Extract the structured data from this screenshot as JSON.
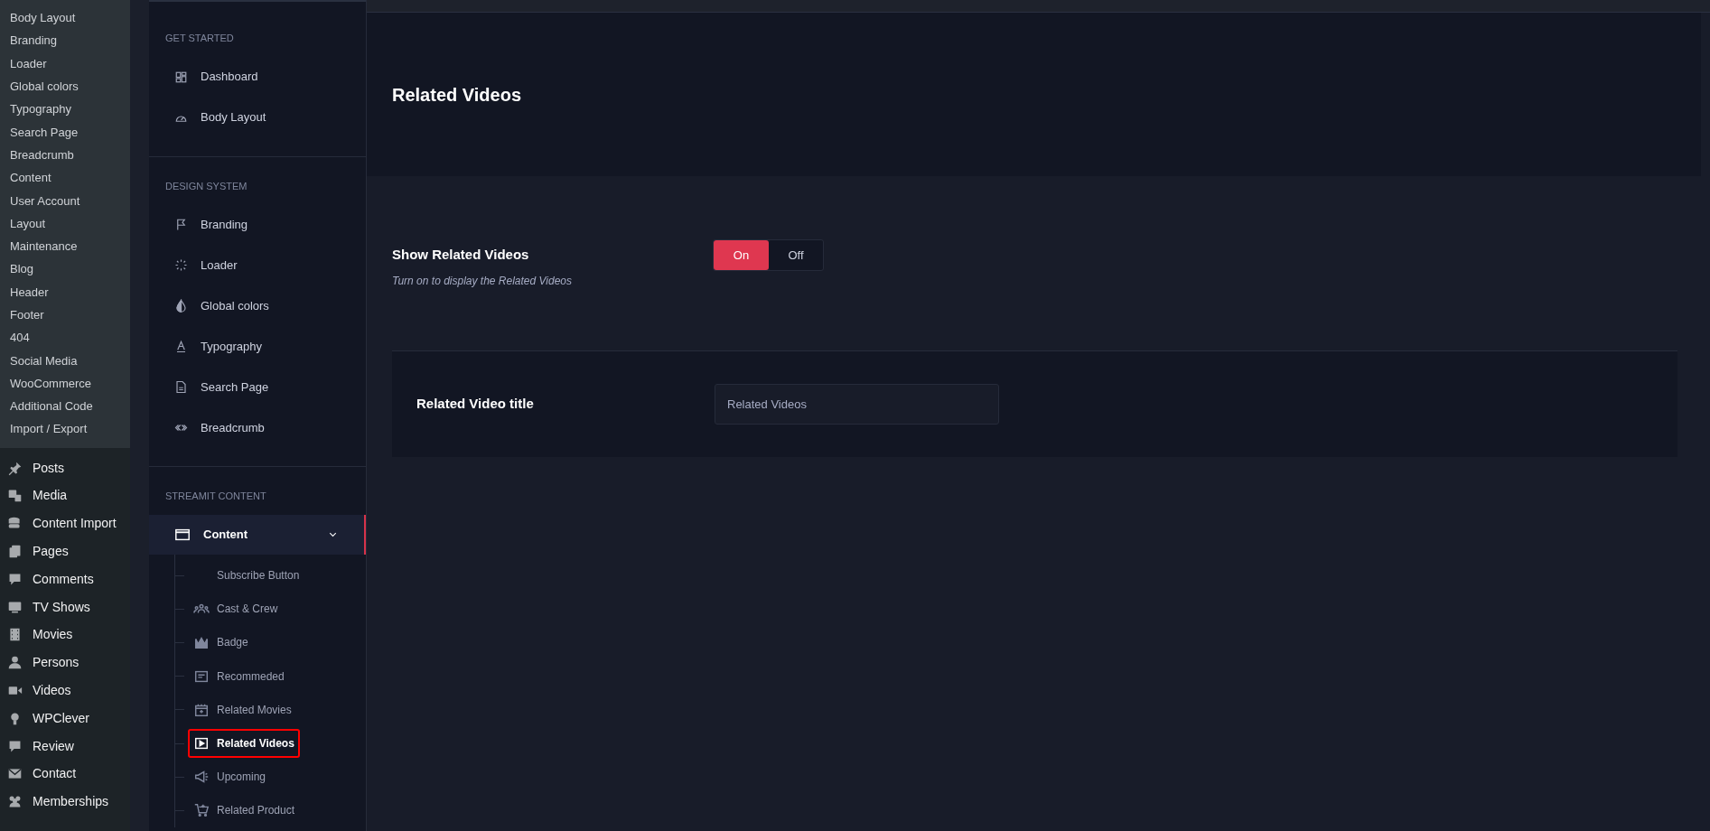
{
  "wp_submenu": [
    "Body Layout",
    "Branding",
    "Loader",
    "Global colors",
    "Typography",
    "Search Page",
    "Breadcrumb",
    "Content",
    "User Account",
    "Layout",
    "Maintenance",
    "Blog",
    "Header",
    "Footer",
    "404",
    "Social Media",
    "WooCommerce",
    "Additional Code",
    "Import / Export"
  ],
  "wp_menu": [
    "Posts",
    "Media",
    "Content Import",
    "Pages",
    "Comments",
    "TV Shows",
    "Movies",
    "Persons",
    "Videos",
    "WPClever",
    "Review",
    "Contact",
    "Memberships"
  ],
  "options_nav": [
    {
      "heading": "GET STARTED",
      "items": [
        {
          "label": "Dashboard"
        },
        {
          "label": "Body Layout"
        }
      ]
    },
    {
      "heading": "DESIGN SYSTEM",
      "items": [
        {
          "label": "Branding"
        },
        {
          "label": "Loader"
        },
        {
          "label": "Global colors"
        },
        {
          "label": "Typography"
        },
        {
          "label": "Search Page"
        },
        {
          "label": "Breadcrumb"
        }
      ]
    },
    {
      "heading": "STREAMIT CONTENT",
      "items": [
        {
          "label": "Content",
          "expanded": true,
          "children": [
            {
              "label": "Subscribe Button",
              "selected": false
            },
            {
              "label": "Cast & Crew",
              "selected": false
            },
            {
              "label": "Badge",
              "selected": false
            },
            {
              "label": "Recommeded",
              "selected": false
            },
            {
              "label": "Related Movies",
              "selected": false
            },
            {
              "label": "Related Videos",
              "selected": true
            },
            {
              "label": "Upcoming",
              "selected": false
            },
            {
              "label": "Related Product",
              "selected": false
            }
          ]
        }
      ]
    }
  ],
  "page_title": "Related Videos",
  "setting": {
    "label": "Show Related Videos",
    "description": "Turn on to display the Related Videos",
    "on_label": "On",
    "off_label": "Off",
    "on": true
  },
  "field": {
    "label": "Related Video title",
    "value": "Related Videos"
  }
}
